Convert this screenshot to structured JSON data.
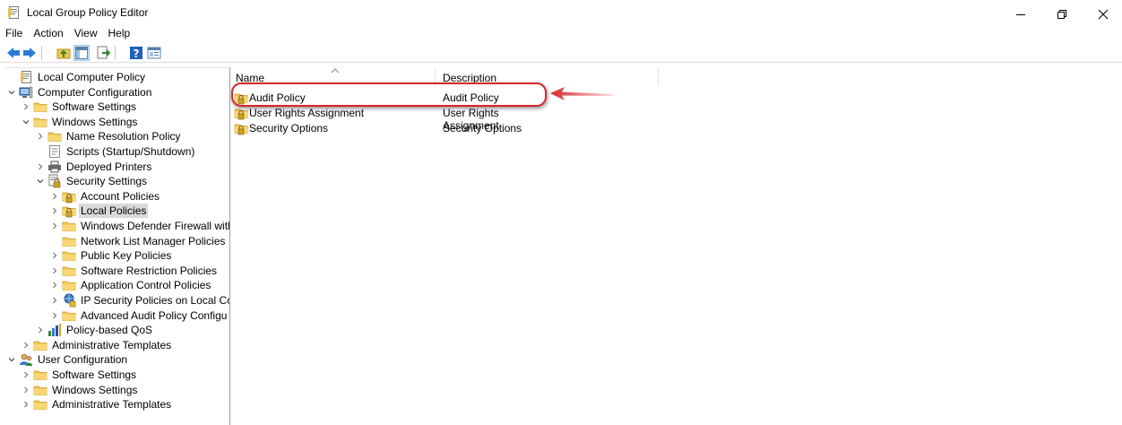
{
  "window": {
    "title": "Local Group Policy Editor",
    "controls": [
      "minimize-icon",
      "restore-icon",
      "close-icon"
    ]
  },
  "menu": [
    "File",
    "Action",
    "View",
    "Help"
  ],
  "toolbar": {
    "icons": [
      "back-arrow-icon",
      "forward-arrow-icon",
      "up-folder-icon",
      "show-hide-tree-icon",
      "export-list-icon",
      "help-icon",
      "properties-icon"
    ]
  },
  "tree": [
    {
      "label": "Local Computer Policy",
      "icon": "policy-doc-icon",
      "level": 0,
      "expand": "none"
    },
    {
      "label": "Computer Configuration",
      "icon": "computer-icon",
      "level": 0,
      "expand": "expanded"
    },
    {
      "label": "Software Settings",
      "icon": "folder-icon",
      "level": 1,
      "expand": "collapsed"
    },
    {
      "label": "Windows Settings",
      "icon": "folder-icon",
      "level": 1,
      "expand": "expanded"
    },
    {
      "label": "Name Resolution Policy",
      "icon": "folder-icon",
      "level": 2,
      "expand": "collapsed"
    },
    {
      "label": "Scripts (Startup/Shutdown)",
      "icon": "script-icon",
      "level": 2,
      "expand": "none"
    },
    {
      "label": "Deployed Printers",
      "icon": "printer-icon",
      "level": 2,
      "expand": "collapsed"
    },
    {
      "label": "Security Settings",
      "icon": "security-settings-icon",
      "level": 2,
      "expand": "expanded"
    },
    {
      "label": "Account Policies",
      "icon": "locked-folder-icon",
      "level": 3,
      "expand": "collapsed"
    },
    {
      "label": "Local Policies",
      "icon": "locked-folder-icon",
      "level": 3,
      "expand": "collapsed",
      "selected": true
    },
    {
      "label": "Windows Defender Firewall with",
      "icon": "folder-icon",
      "level": 3,
      "expand": "collapsed"
    },
    {
      "label": "Network List Manager Policies",
      "icon": "folder-icon",
      "level": 3,
      "expand": "none"
    },
    {
      "label": "Public Key Policies",
      "icon": "folder-icon",
      "level": 3,
      "expand": "collapsed"
    },
    {
      "label": "Software Restriction Policies",
      "icon": "folder-icon",
      "level": 3,
      "expand": "collapsed"
    },
    {
      "label": "Application Control Policies",
      "icon": "folder-icon",
      "level": 3,
      "expand": "collapsed"
    },
    {
      "label": "IP Security Policies on Local Co",
      "icon": "ip-security-icon",
      "level": 3,
      "expand": "collapsed"
    },
    {
      "label": "Advanced Audit Policy Configu",
      "icon": "folder-icon",
      "level": 3,
      "expand": "collapsed"
    },
    {
      "label": "Policy-based QoS",
      "icon": "qos-chart-icon",
      "level": 2,
      "expand": "collapsed"
    },
    {
      "label": "Administrative Templates",
      "icon": "folder-icon",
      "level": 1,
      "expand": "collapsed"
    },
    {
      "label": "User Configuration",
      "icon": "users-icon",
      "level": 0,
      "expand": "expanded"
    },
    {
      "label": "Software Settings",
      "icon": "folder-icon",
      "level": 1,
      "expand": "collapsed"
    },
    {
      "label": "Windows Settings",
      "icon": "folder-icon",
      "level": 1,
      "expand": "collapsed"
    },
    {
      "label": "Administrative Templates",
      "icon": "folder-icon",
      "level": 1,
      "expand": "collapsed"
    }
  ],
  "list": {
    "columns": {
      "name": "Name",
      "description": "Description"
    },
    "rows": [
      {
        "name": "Audit Policy",
        "description": "Audit Policy",
        "icon": "locked-folder-icon"
      },
      {
        "name": "User Rights Assignment",
        "description": "User Rights Assignment",
        "icon": "locked-folder-icon"
      },
      {
        "name": "Security Options",
        "description": "Security Options",
        "icon": "locked-folder-icon"
      }
    ]
  },
  "annotation": {
    "highlighted_row": "Audit Policy",
    "color": "#d6262b",
    "shape": "rounded-rectangle-with-arrow"
  },
  "colors": {
    "folder": "#f3c74f",
    "lock": "#c9a227",
    "selection": "#d9d9d9",
    "annotation": "#d6262b"
  }
}
